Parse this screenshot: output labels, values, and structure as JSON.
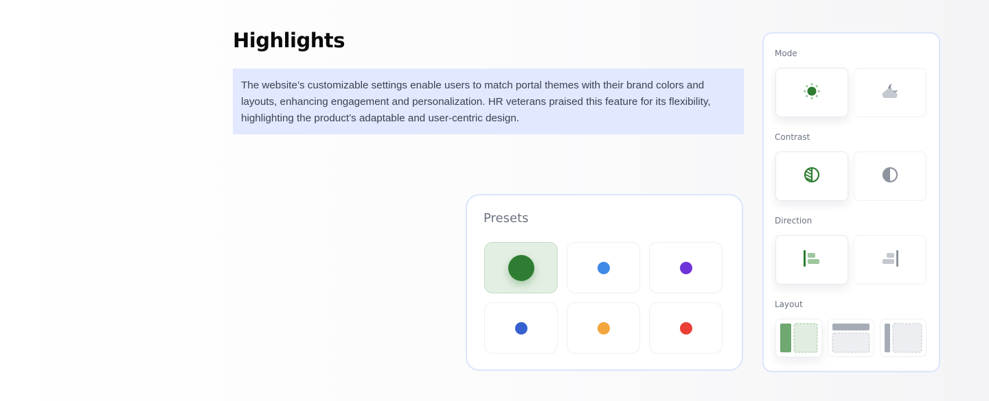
{
  "highlights": {
    "title": "Highlights",
    "description": "The website’s customizable settings enable users to match portal themes with their brand colors and layouts, enhancing engagement and personalization. HR veterans praised this feature for its flexibility, highlighting the product’s adaptable and user-centric design."
  },
  "presets": {
    "title": "Presets",
    "selected_index": 0,
    "colors": [
      {
        "name": "green",
        "hex": "#2f7d32"
      },
      {
        "name": "blue",
        "hex": "#3e8ae6"
      },
      {
        "name": "purple",
        "hex": "#6e33d9"
      },
      {
        "name": "indigo",
        "hex": "#3562cf"
      },
      {
        "name": "orange",
        "hex": "#f2a63b"
      },
      {
        "name": "red",
        "hex": "#ea3e36"
      }
    ]
  },
  "settings": {
    "mode": {
      "label": "Mode",
      "options": [
        "sun-icon",
        "moon-cloud-icon"
      ],
      "selected_index": 0
    },
    "contrast": {
      "label": "Contrast",
      "options": [
        "contrast-striped-icon",
        "half-circle-icon"
      ],
      "selected_index": 0
    },
    "direction": {
      "label": "Direction",
      "options": [
        "align-left-icon",
        "align-right-icon"
      ],
      "selected_index": 0
    },
    "layout": {
      "label": "Layout",
      "options": [
        "layout-vertical-icon",
        "layout-horizontal-icon",
        "layout-mini-icon"
      ],
      "selected_index": 0
    }
  },
  "colors": {
    "accent": "#2f7d32",
    "inactive_icon": "#a6acb6",
    "desc_background": "#e1e8ff",
    "card_border": "#dbe5fb"
  }
}
